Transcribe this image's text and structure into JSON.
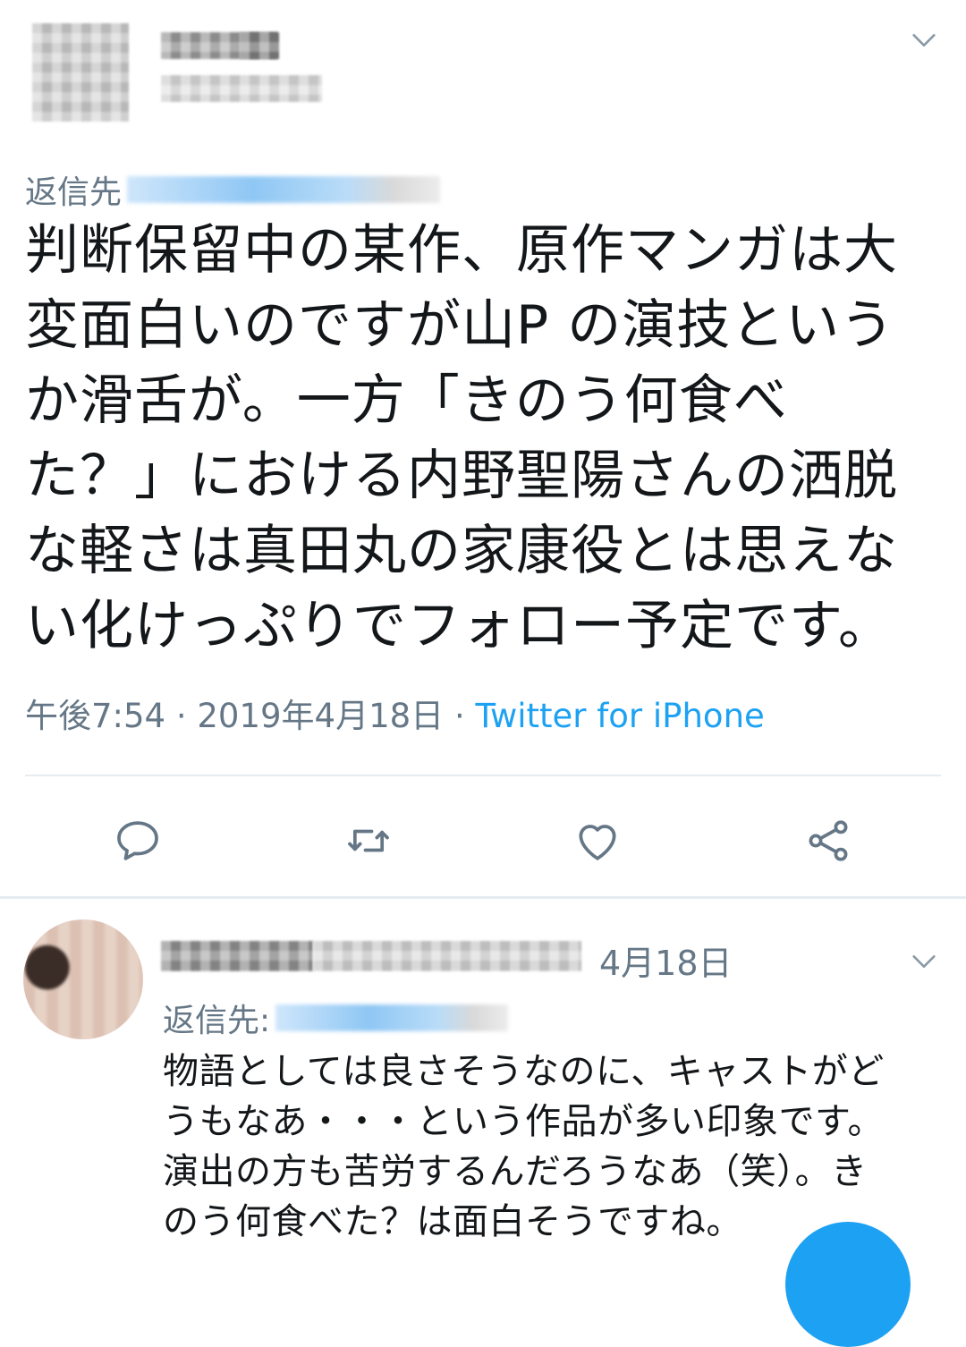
{
  "main_tweet": {
    "reply_to_label": "返信先",
    "text": "判断保留中の某作、原作マンガは大\n変面白いのですが山P の演技という\nか滑舌が。一方「きのう何食べ\nた？」における内野聖陽さんの洒脱\nな軽さは真田丸の家康役とは思えな\nい化けっぷりでフォロー予定です。",
    "time": "午後7:54",
    "date": "2019年4月18日",
    "separator": " · ",
    "source": "Twitter for iPhone",
    "caret_icon": "chevron-down-icon"
  },
  "actions": [
    {
      "name": "reply",
      "icon": "comment-icon"
    },
    {
      "name": "retweet",
      "icon": "retweet-icon"
    },
    {
      "name": "like",
      "icon": "heart-icon"
    },
    {
      "name": "share",
      "icon": "share-icon"
    }
  ],
  "reply_tweet": {
    "date": "4月18日",
    "reply_to_label": "返信先:",
    "text": "物語としては良さそうなのに、キャストがど\nうもなあ・・・という作品が多い印象です。\n演出の方も苦労するんだろうなあ（笑）。き\nのう何食べた？は面白そうですね。",
    "caret_icon": "chevron-down-icon"
  },
  "colors": {
    "text": "#14171a",
    "secondary": "#657786",
    "accent": "#1da1f2",
    "divider": "#e6ecf0"
  }
}
